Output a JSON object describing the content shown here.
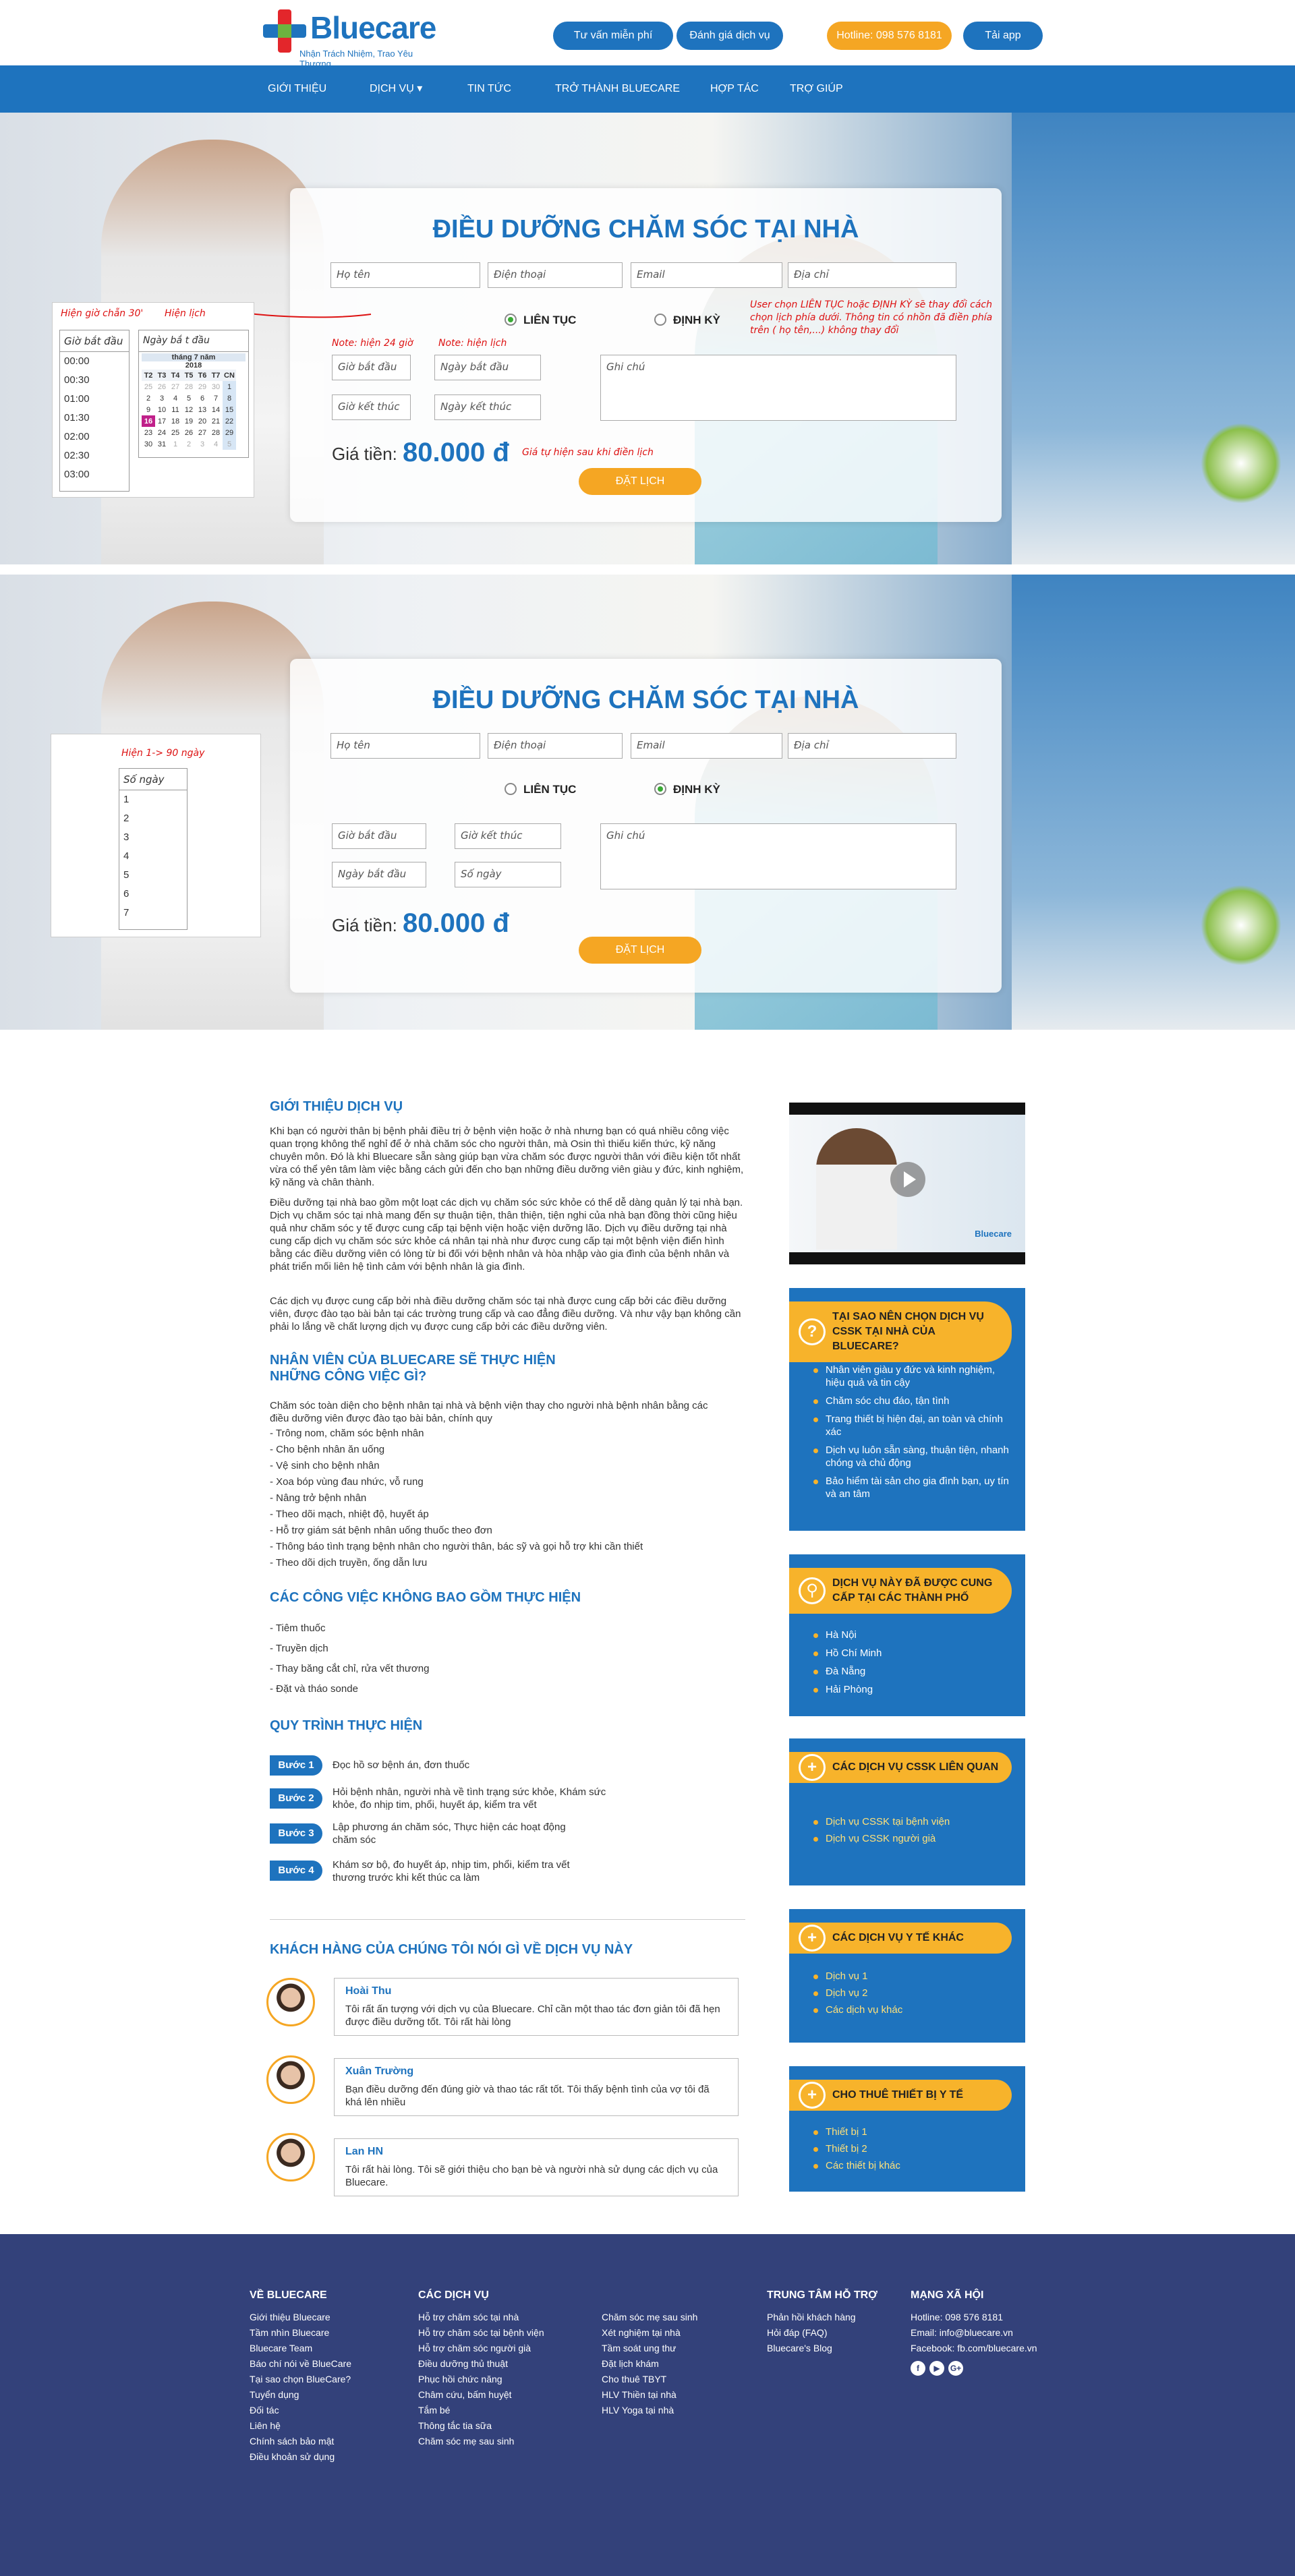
{
  "header": {
    "logo_text": "Bluecare",
    "logo_sub": "Nhận Trách Nhiệm, Trao Yêu Thương",
    "btn_consult": "Tư vấn miễn phí",
    "btn_review": "Đánh giá dịch vụ",
    "btn_hotline": "Hotline: 098 576 8181",
    "btn_app": "Tải app"
  },
  "nav": [
    "GIỚI THIỆU",
    "DỊCH VỤ ▾",
    "TIN TỨC",
    "TRỞ THÀNH BLUECARE",
    "HỢP TÁC",
    "TRỢ GIÚP"
  ],
  "form1": {
    "title": "ĐIỀU DƯỠNG CHĂM SÓC TẠI NHÀ",
    "name": "Họ tên",
    "phone": "Điện thoại",
    "email": "Email",
    "address": "Địa chỉ",
    "radio_continuous": "LIÊN TỤC",
    "radio_periodic": "ĐỊNH KỲ",
    "note_red": "User chọn LIÊN TỤC hoặc ĐỊNH KỲ sẽ thay đổi cách chọn lịch phía dưới. Thông tin có nhồn đã điền phía trên ( họ tên,...) không thay đổi",
    "note_24h": "Note: hiện 24 giờ",
    "note_cal": "Note: hiện lịch",
    "start_time": "Giờ bắt đầu",
    "start_date": "Ngày bắt đầu",
    "end_time": "Giờ kết thúc",
    "end_date": "Ngày kết thúc",
    "notes": "Ghi chú",
    "price_label": "Giá tiền:",
    "price_value": "80.000 đ",
    "price_note": "Giá tự hiện sau khi điền lịch",
    "submit": "ĐẶT LỊCH"
  },
  "popup1": {
    "label_time": "Hiện giờ chẵn 30'",
    "label_cal": "Hiện lịch",
    "time_header": "Giờ bắt đầu",
    "times": [
      "00:00",
      "00:30",
      "01:00",
      "01:30",
      "02:00",
      "02:30",
      "03:00"
    ],
    "date_header": "Ngày bắ t đầu",
    "cal_month": "tháng 7 năm",
    "cal_year": "2018",
    "cal_days": [
      "T2",
      "T3",
      "T4",
      "T5",
      "T6",
      "T7",
      "CN"
    ],
    "cal_rows": [
      [
        "25",
        "26",
        "27",
        "28",
        "29",
        "30",
        "1"
      ],
      [
        "2",
        "3",
        "4",
        "5",
        "6",
        "7",
        "8"
      ],
      [
        "9",
        "10",
        "11",
        "12",
        "13",
        "14",
        "15"
      ],
      [
        "16",
        "17",
        "18",
        "19",
        "20",
        "21",
        "22"
      ],
      [
        "23",
        "24",
        "25",
        "26",
        "27",
        "28",
        "29"
      ],
      [
        "30",
        "31",
        "1",
        "2",
        "3",
        "4",
        "5"
      ]
    ]
  },
  "form2": {
    "title": "ĐIỀU DƯỠNG CHĂM SÓC TẠI NHÀ",
    "name": "Họ tên",
    "phone": "Điện thoại",
    "email": "Email",
    "address": "Địa chỉ",
    "radio_continuous": "LIÊN TỤC",
    "radio_periodic": "ĐỊNH KỲ",
    "start_time": "Giờ bắt đầu",
    "end_time": "Giờ kết thúc",
    "start_date": "Ngày bắt đầu",
    "num_days": "Số ngày",
    "notes": "Ghi chú",
    "price_label": "Giá tiền:",
    "price_value": "80.000 đ",
    "submit": "ĐẶT LỊCH"
  },
  "popup2": {
    "label": "Hiện 1-> 90 ngày",
    "header": "Số ngày",
    "items": [
      "1",
      "2",
      "3",
      "4",
      "5",
      "6",
      "7"
    ]
  },
  "intro": {
    "title": "GIỚI THIỆU DỊCH VỤ",
    "p1": "Khi bạn có người thân bị bệnh phải điều trị ở bệnh viện hoặc ở nhà nhưng bạn có quá nhiều công việc quan trọng không thể nghỉ để ở nhà chăm sóc cho người thân, mà Osin thì thiếu kiến thức, kỹ năng chuyên môn. Đó là khi Bluecare sẵn sàng giúp bạn vừa chăm sóc được người thân với điều kiện tốt nhất vừa có thể yên tâm làm việc bằng cách gửi đến cho bạn những điều dưỡng viên giàu y đức, kinh nghiệm, kỹ năng và chân thành.",
    "p2": "Điều dưỡng tại nhà bao gồm một loạt các dịch vụ chăm sóc sức khỏe có thể dễ dàng quản lý tại nhà bạn. Dịch vụ chăm sóc tại nhà mang đến sự thuận tiện, thân thiện, tiện nghi của nhà bạn đồng thời cũng hiệu quả như chăm sóc y tế được cung cấp tại bệnh viện hoặc viện dưỡng lão. Dịch vụ điều dưỡng tại nhà cung cấp dịch vụ chăm sóc sức khỏe cá nhân tại nhà như được cung cấp tại một bệnh viện điển hình bằng các điều dưỡng viên có lòng từ bi đối với bệnh nhân và hòa nhập vào gia đình của bệnh nhân và phát triển mối liên hệ tình cảm với bệnh nhân là gia đình.",
    "p3": "Các dịch vụ được cung cấp bởi nhà điều dưỡng chăm sóc tại nhà được cung cấp bởi các điều dưỡng viên, được đào tạo bài bản tại các trường trung cấp và cao đẳng điều dưỡng. Và như vậy bạn không cần phải lo lắng về chất lượng dịch vụ được cung cấp bởi các điều dưỡng viên."
  },
  "tasks": {
    "title": "NHÂN VIÊN CỦA BLUECARE SẼ THỰC HIỆN NHỮNG CÔNG VIỆC GÌ?",
    "intro": "Chăm sóc toàn diện cho bệnh nhân tại nhà và bệnh viện thay cho người nhà bệnh nhân bằng các điều dưỡng viên được đào tạo bài bản, chính quy",
    "items": [
      "- Trông nom, chăm sóc bệnh nhân",
      "- Cho bệnh nhân ăn uống",
      "- Vệ sinh cho bệnh nhân",
      "- Xoa bóp vùng đau nhức, vỗ rung",
      "- Nâng trở bệnh nhân",
      "- Theo dõi mạch, nhiệt độ, huyết áp",
      "- Hỗ trợ giám sát bệnh nhân uống thuốc theo đơn",
      "- Thông báo tình trạng bệnh nhân cho người thân, bác sỹ và gọi hỗ trợ khi cần thiết",
      "- Theo dõi dịch truyền, ống dẫn lưu"
    ]
  },
  "excluded": {
    "title": "CÁC CÔNG VIỆC KHÔNG BAO GỒM THỰC HIỆN",
    "items": [
      "- Tiêm thuốc",
      "- Truyền dịch",
      "- Thay băng cắt chỉ, rửa vết thương",
      "- Đặt và tháo sonde"
    ]
  },
  "process": {
    "title": "QUY TRÌNH THỰC HIỆN",
    "steps": [
      {
        "label": "Bước 1",
        "text": "Đọc hồ sơ bệnh án, đơn thuốc"
      },
      {
        "label": "Bước 2",
        "text": "Hỏi bệnh nhân, người nhà về tình trạng sức khỏe, Khám sức khỏe, đo nhịp tim, phổi, huyết áp, kiểm tra vết"
      },
      {
        "label": "Bước 3",
        "text": "Lập phương án chăm sóc, Thực hiện các hoạt động chăm sóc"
      },
      {
        "label": "Bước 4",
        "text": "Khám sơ bộ, đo huyết áp, nhịp tim, phổi, kiểm tra vết thương trước khi kết thúc ca làm"
      }
    ]
  },
  "testimonials": {
    "title": "KHÁCH HÀNG CỦA CHÚNG TÔI NÓI GÌ VỀ DỊCH VỤ NÀY",
    "items": [
      {
        "name": "Hoài Thu",
        "text": "Tôi rất ấn tượng với dịch vụ của Bluecare. Chỉ cần một thao tác đơn giản tôi đã hẹn được điều dưỡng tốt. Tôi rất hài lòng"
      },
      {
        "name": "Xuân Trường",
        "text": "Bạn điều dưỡng đến đúng giờ và thao tác rất tốt. Tôi thấy bệnh tình của vợ tôi đã khá lên nhiều"
      },
      {
        "name": "Lan HN",
        "text": "Tôi rất hài lòng. Tôi sẽ giới thiệu cho bạn bè và người nhà sử dụng các dịch vụ của Bluecare."
      }
    ]
  },
  "sidebar": {
    "video_logo": "Bluecare",
    "why": {
      "title": "TẠI SAO NÊN CHỌN DỊCH VỤ CSSK TẠI NHÀ CỦA BLUECARE?",
      "items": [
        "Nhân viên giàu y đức và kinh nghiệm, hiệu quả và tin cậy",
        "Chăm sóc chu đáo, tận tình",
        "Trang thiết bị hiện đại, an toàn và chính xác",
        "Dịch vụ luôn sẵn sàng, thuận tiện, nhanh chóng và chủ động",
        "Bảo hiểm tài sản cho gia đình bạn, uy tín và an tâm"
      ]
    },
    "cities": {
      "title": "DỊCH VỤ NÀY ĐÃ ĐƯỢC CUNG CẤP TẠI CÁC THÀNH PHỐ",
      "items": [
        "Hà Nội",
        "Hồ Chí Minh",
        "Đà Nẵng",
        "Hải Phòng"
      ]
    },
    "related": {
      "title": "CÁC DỊCH VỤ CSSK LIÊN QUAN",
      "items": [
        "Dịch vụ CSSK tại bệnh viện",
        "Dịch vụ CSSK người già"
      ]
    },
    "medical": {
      "title": "CÁC DỊCH VỤ Y TẾ KHÁC",
      "items": [
        "Dịch vụ 1",
        "Dịch vụ 2",
        "Các dịch vụ khác"
      ]
    },
    "rent": {
      "title": "CHO THUÊ THIẾT BỊ Y TẾ",
      "items": [
        "Thiết bị 1",
        "Thiết bị 2",
        "Các thiết bị khác"
      ]
    }
  },
  "footer": {
    "about": {
      "title": "VỀ BLUECARE",
      "items": [
        "Giới thiệu Bluecare",
        "Tầm nhìn Bluecare",
        "Bluecare Team",
        "Báo chí nói về BlueCare",
        "Tại sao chọn BlueCare?",
        "Tuyển dụng",
        "Đối tác",
        "Liên hệ",
        "Chính sách bảo mật",
        "Điều khoản sử dụng"
      ]
    },
    "services": {
      "title": "CÁC DỊCH VỤ",
      "col1": [
        "Hỗ trợ chăm sóc tại nhà",
        "Hỗ trợ chăm sóc tại bệnh viện",
        "Hỗ trợ chăm sóc người già",
        "Điều dưỡng thủ thuật",
        "Phục hồi chức năng",
        "Châm cứu, bấm huyệt",
        "Tắm bé",
        "Thông tắc tia sữa",
        "Chăm sóc mẹ sau sinh"
      ],
      "col2": [
        "Chăm sóc mẹ sau sinh",
        "Xét nghiệm tại nhà",
        "Tầm soát ung thư",
        "Đặt lịch khám",
        "Cho thuê TBYT",
        "HLV Thiền tại nhà",
        "HLV Yoga tại nhà"
      ]
    },
    "support": {
      "title": "TRUNG TÂM HỖ TRỢ",
      "items": [
        "Phản hồi khách hàng",
        "Hỏi đáp (FAQ)",
        "Bluecare's Blog"
      ]
    },
    "social": {
      "title": "MẠNG XÃ HỘI",
      "items": [
        "Hotline: 098 576 8181",
        "Email: info@bluecare.vn",
        "Facebook: fb.com/bluecare.vn"
      ],
      "icons": [
        "f",
        "▶",
        "G+"
      ]
    }
  }
}
